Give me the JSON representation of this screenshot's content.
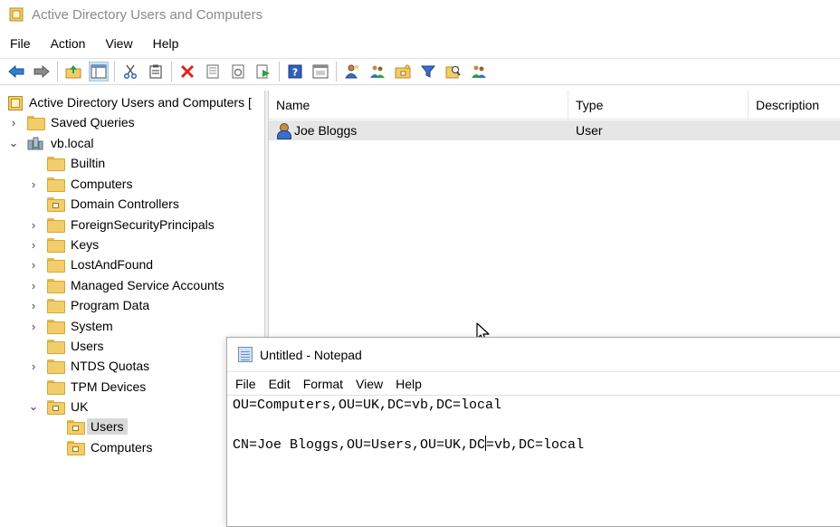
{
  "window": {
    "title": "Active Directory Users and Computers"
  },
  "menu": [
    "File",
    "Action",
    "View",
    "Help"
  ],
  "toolbar": {
    "buttons": [
      "back-icon",
      "forward-icon",
      "up-folder-icon",
      "show-hide-tree-icon",
      "cut-icon",
      "paste-icon",
      "delete-icon",
      "properties-icon",
      "refresh-icon",
      "export-list-icon",
      "help-icon",
      "console-tree-icon",
      "new-user-icon",
      "new-group-icon",
      "new-ou-icon",
      "filter-icon",
      "find-icon",
      "add-to-group-icon"
    ]
  },
  "tree": {
    "root_label": "Active Directory Users and Computers [",
    "saved_queries": "Saved Queries",
    "domain": "vb.local",
    "children": [
      "Builtin",
      "Computers",
      "Domain Controllers",
      "ForeignSecurityPrincipals",
      "Keys",
      "LostAndFound",
      "Managed Service Accounts",
      "Program Data",
      "System",
      "Users",
      "NTDS Quotas",
      "TPM Devices",
      "UK"
    ],
    "uk_children": [
      "Users",
      "Computers"
    ]
  },
  "list": {
    "columns": [
      "Name",
      "Type",
      "Description"
    ],
    "rows": [
      {
        "name": "Joe Bloggs",
        "type": "User",
        "description": ""
      }
    ]
  },
  "notepad": {
    "title": "Untitled - Notepad",
    "menu": [
      "File",
      "Edit",
      "Format",
      "View",
      "Help"
    ],
    "line1": "OU=Computers,OU=UK,DC=vb,DC=local",
    "line2": "",
    "line3_before_caret": "CN=Joe Bloggs,OU=Users,OU=UK,DC",
    "line3_after_caret": "=vb,DC=local"
  }
}
